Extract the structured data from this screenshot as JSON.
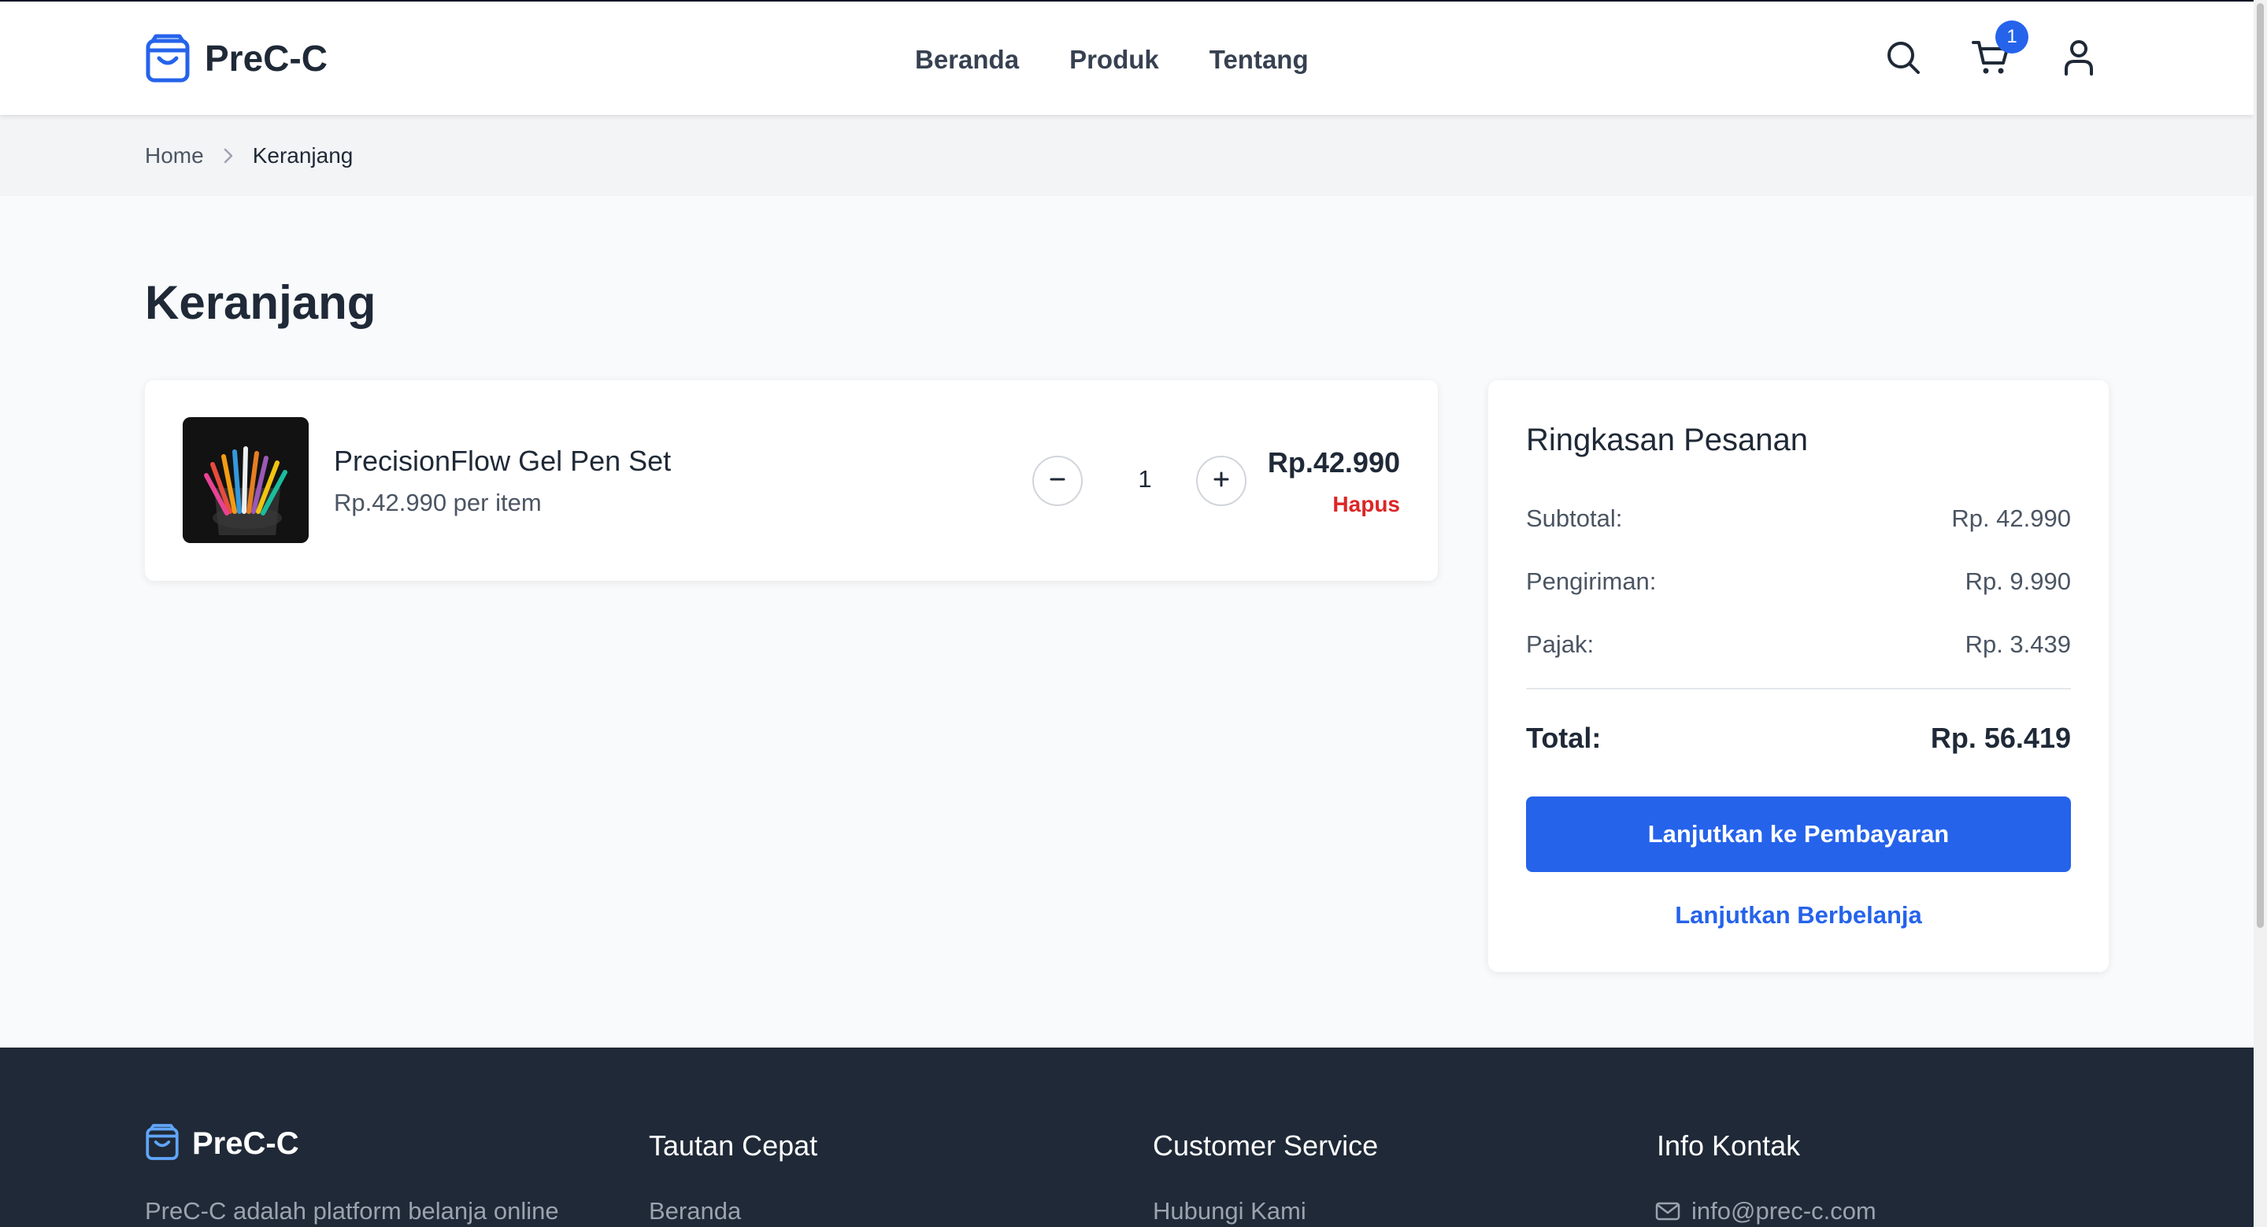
{
  "brand": {
    "name": "PreC-C"
  },
  "nav": {
    "items": [
      {
        "label": "Beranda"
      },
      {
        "label": "Produk"
      },
      {
        "label": "Tentang"
      }
    ]
  },
  "header": {
    "cart_count": "1",
    "icons": [
      "search-icon",
      "cart-icon",
      "user-icon"
    ]
  },
  "breadcrumb": {
    "home": "Home",
    "current": "Keranjang"
  },
  "page": {
    "title": "Keranjang"
  },
  "cart": {
    "items": [
      {
        "name": "PrecisionFlow Gel Pen Set",
        "unit_price": "Rp.42.990 per item",
        "quantity": "1",
        "price": "Rp.42.990",
        "remove_label": "Hapus"
      }
    ]
  },
  "summary": {
    "title": "Ringkasan Pesanan",
    "rows": [
      {
        "label": "Subtotal:",
        "value": "Rp. 42.990"
      },
      {
        "label": "Pengiriman:",
        "value": "Rp. 9.990"
      },
      {
        "label": "Pajak:",
        "value": "Rp. 3.439"
      }
    ],
    "total_label": "Total:",
    "total_value": "Rp. 56.419",
    "checkout_label": "Lanjutkan ke Pembayaran",
    "continue_label": "Lanjutkan Berbelanja"
  },
  "footer": {
    "brand": "PreC-C",
    "description": "PreC-C adalah platform belanja online",
    "columns": [
      {
        "heading": "Tautan Cepat",
        "first_link": "Beranda"
      },
      {
        "heading": "Customer Service",
        "first_link": "Hubungi Kami"
      },
      {
        "heading": "Info Kontak",
        "first_link": "info@prec-c.com"
      }
    ]
  },
  "colors": {
    "primary": "#2563eb",
    "danger": "#dc2626",
    "footer_bg": "#1f2937",
    "page_bg": "#f9fafb"
  }
}
